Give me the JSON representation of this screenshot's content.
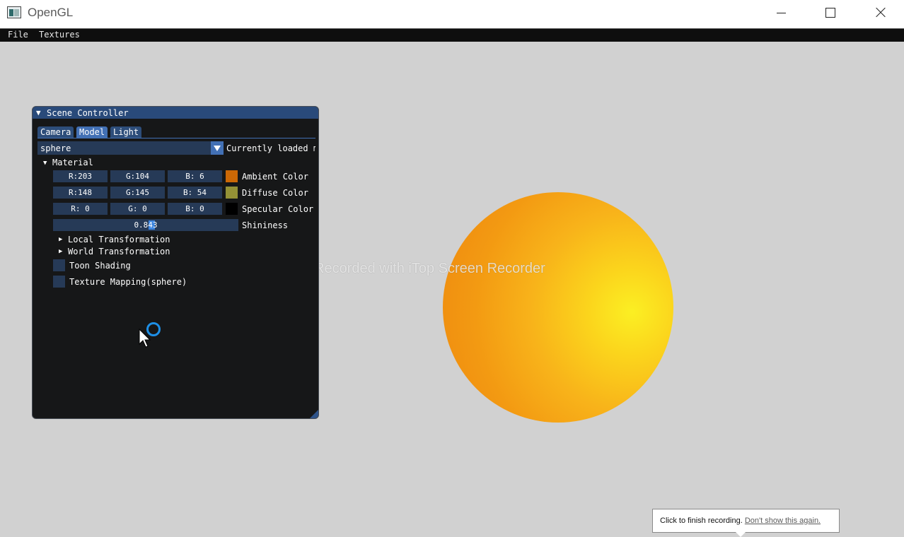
{
  "window": {
    "title": "OpenGL",
    "icon": "opengl-app-icon"
  },
  "menu": {
    "items": [
      "File",
      "Textures"
    ]
  },
  "watermark": "Recorded with iTop Screen Recorder",
  "scene_controller": {
    "title": "Scene Controller",
    "tabs": [
      "Camera",
      "Model",
      "Light"
    ],
    "active_tab": "Model",
    "model_combo": {
      "value": "sphere",
      "label": "Currently loaded m"
    },
    "material": {
      "label": "Material",
      "ambient": {
        "r": "R:203",
        "g": "G:104",
        "b": "B:  6",
        "label": "Ambient Color",
        "color": "#cb6806"
      },
      "diffuse": {
        "r": "R:148",
        "g": "G:145",
        "b": "B: 54",
        "label": "Diffuse Color",
        "color": "#949136"
      },
      "specular": {
        "r": "R:  0",
        "g": "G:  0",
        "b": "B:  0",
        "label": "Specular  Color",
        "color": "#000000"
      },
      "shininess": {
        "value": "0.843",
        "label": "Shininess"
      }
    },
    "local_transformation": "Local Transformation",
    "world_transformation": "World Transformation",
    "toon_shading": "Toon Shading",
    "texture_mapping": "Texture Mapping(sphere)"
  },
  "recorder_popup": {
    "text": "Click to finish recording.",
    "link": "Don't show this again."
  },
  "colors": {
    "viewport": "#d1d1d1",
    "imgui_title": "#294a7a",
    "imgui_bg": "#161718",
    "sphere": "#f8b31a"
  }
}
